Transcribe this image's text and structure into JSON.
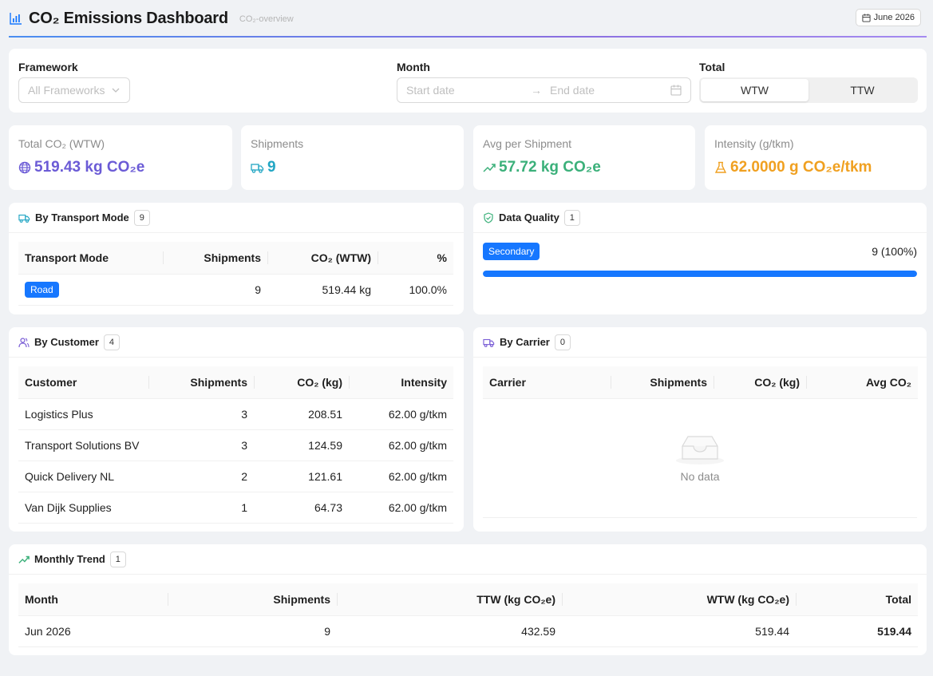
{
  "header": {
    "title": "CO₂ Emissions Dashboard",
    "subtitle": "CO₂-overview",
    "date_badge": "June 2026"
  },
  "filters": {
    "framework_label": "Framework",
    "framework_placeholder": "All Frameworks",
    "month_label": "Month",
    "start_placeholder": "Start date",
    "end_placeholder": "End date",
    "total_label": "Total",
    "total_options": [
      "WTW",
      "TTW"
    ],
    "total_selected": "WTW"
  },
  "stats": [
    {
      "label": "Total CO₂ (WTW)",
      "value": "519.43 kg CO₂e",
      "color": "#6b5bd6",
      "icon": "globe-icon"
    },
    {
      "label": "Shipments",
      "value": "9",
      "color": "#22a6c4",
      "icon": "truck-icon"
    },
    {
      "label": "Avg per Shipment",
      "value": "57.72 kg CO₂e",
      "color": "#3bb07a",
      "icon": "trend-icon"
    },
    {
      "label": "Intensity (g/tkm)",
      "value": "62.0000 g CO₂e/tkm",
      "color": "#f0a020",
      "icon": "flask-icon"
    }
  ],
  "transport": {
    "title": "By Transport Mode",
    "count": "9",
    "columns": [
      "Transport Mode",
      "Shipments",
      "CO₂ (WTW)",
      "%"
    ],
    "rows": [
      {
        "mode": "Road",
        "shipments": "9",
        "co2": "519.44 kg",
        "pct": "100.0%"
      }
    ]
  },
  "quality": {
    "title": "Data Quality",
    "count": "1",
    "tag": "Secondary",
    "value": "9 (100%)",
    "fraction": 1.0
  },
  "customer": {
    "title": "By Customer",
    "count": "4",
    "columns": [
      "Customer",
      "Shipments",
      "CO₂ (kg)",
      "Intensity"
    ],
    "rows": [
      {
        "name": "Logistics Plus",
        "shipments": "3",
        "co2": "208.51",
        "intensity": "62.00 g/tkm"
      },
      {
        "name": "Transport Solutions BV",
        "shipments": "3",
        "co2": "124.59",
        "intensity": "62.00 g/tkm"
      },
      {
        "name": "Quick Delivery NL",
        "shipments": "2",
        "co2": "121.61",
        "intensity": "62.00 g/tkm"
      },
      {
        "name": "Van Dijk Supplies",
        "shipments": "1",
        "co2": "64.73",
        "intensity": "62.00 g/tkm"
      }
    ]
  },
  "carrier": {
    "title": "By Carrier",
    "count": "0",
    "columns": [
      "Carrier",
      "Shipments",
      "CO₂ (kg)",
      "Avg CO₂"
    ],
    "empty_text": "No data"
  },
  "trend": {
    "title": "Monthly Trend",
    "count": "1",
    "columns": [
      "Month",
      "Shipments",
      "TTW (kg CO₂e)",
      "WTW (kg CO₂e)",
      "Total"
    ],
    "rows": [
      {
        "month": "Jun 2026",
        "shipments": "9",
        "ttw": "432.59",
        "wtw": "519.44",
        "total": "519.44"
      }
    ]
  }
}
